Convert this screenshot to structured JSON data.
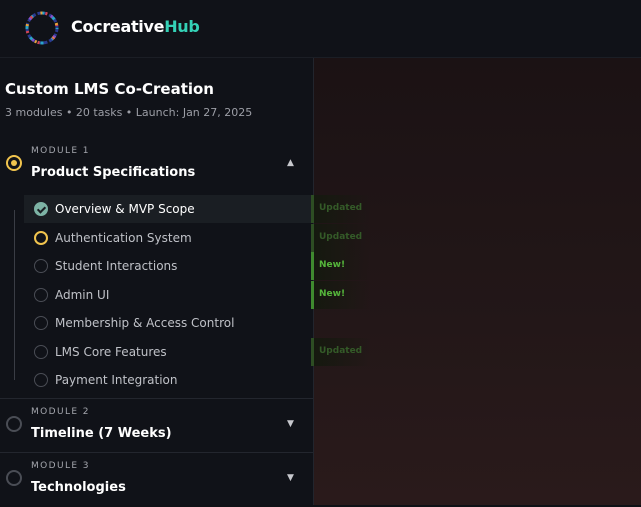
{
  "brand": {
    "part1": "Cocreative",
    "part2": "Hub"
  },
  "course": {
    "title": "Custom LMS Co-Creation",
    "meta": "3 modules • 20 tasks • Launch: Jan 27, 2025"
  },
  "modules": [
    {
      "label": "MODULE 1",
      "name": "Product Specifications",
      "expanded": true,
      "chevron": "▲",
      "tasks": [
        {
          "label": "Overview & MVP Scope",
          "status": "done",
          "badge": "Updated"
        },
        {
          "label": "Authentication System",
          "status": "in-progress",
          "badge": "Updated"
        },
        {
          "label": "Student Interactions",
          "status": "todo",
          "badge": "New!"
        },
        {
          "label": "Admin UI",
          "status": "todo",
          "badge": "New!"
        },
        {
          "label": "Membership & Access Control",
          "status": "todo",
          "badge": ""
        },
        {
          "label": "LMS Core Features",
          "status": "todo",
          "badge": "Updated"
        },
        {
          "label": "Payment Integration",
          "status": "todo",
          "badge": ""
        }
      ]
    },
    {
      "label": "MODULE 2",
      "name": "Timeline (7 Weeks)",
      "expanded": false,
      "chevron": "▼"
    },
    {
      "label": "MODULE 3",
      "name": "Technologies",
      "expanded": false,
      "chevron": "▼"
    }
  ],
  "colors": {
    "accent_teal": "#34d1b6",
    "progress_yellow": "#f1c44e",
    "new_green": "#55b53b"
  }
}
